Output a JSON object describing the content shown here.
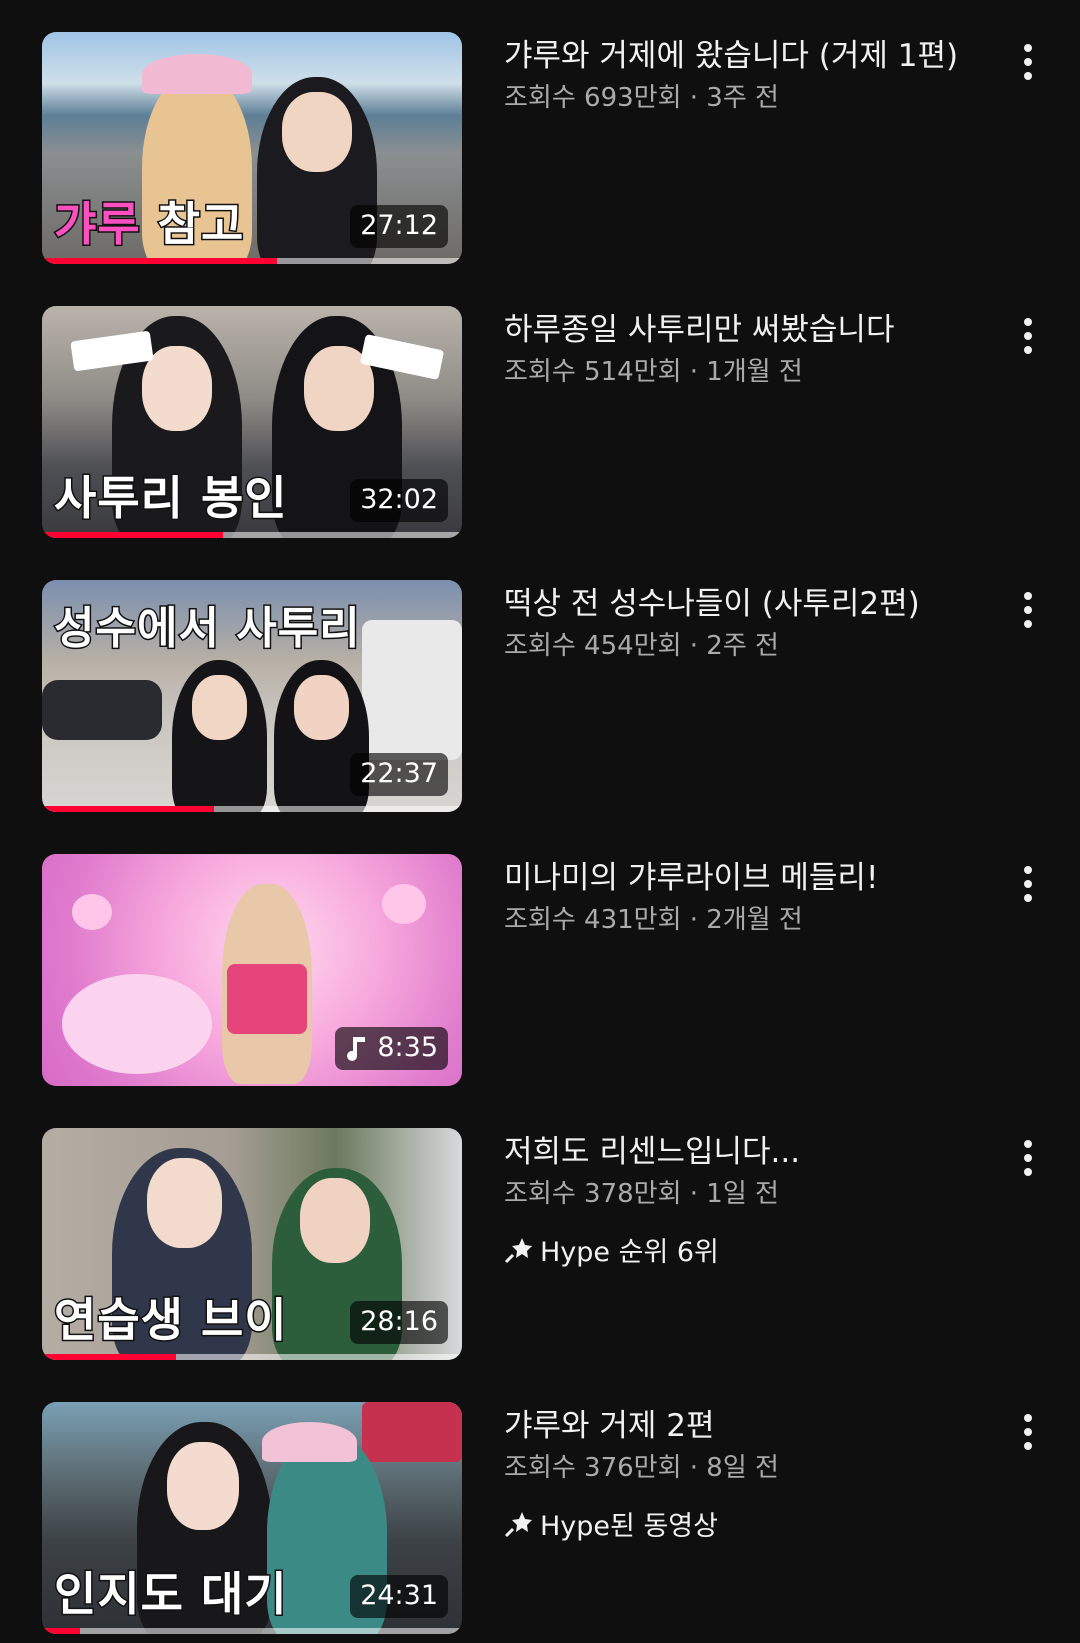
{
  "colors": {
    "background": "#0f0f0f",
    "progress": "#ff0033",
    "secondary_text": "#aaaaaa"
  },
  "videos": [
    {
      "title": "갸루와 거제에 왔습니다 (거제 1편)",
      "views": "조회수 693만회 · 3주 전",
      "duration": "27:12",
      "thumb_caption_pink": "갸루",
      "thumb_caption": " 참고",
      "watched": 0.56,
      "badge": ""
    },
    {
      "title": "하루종일 사투리만 써봤습니다",
      "views": "조회수 514만회 · 1개월 전",
      "duration": "32:02",
      "thumb_caption_pink": "",
      "thumb_caption": "사투리 봉인",
      "watched": 0.43,
      "badge": ""
    },
    {
      "title": "떡상 전 성수나들이 (사투리2편)",
      "views": "조회수 454만회 · 2주 전",
      "duration": "22:37",
      "thumb_caption_pink": "",
      "thumb_caption": "성수에서 사투리",
      "watched": 0.41,
      "badge": ""
    },
    {
      "title": "미나미의 갸루라이브 메들리!",
      "views": "조회수 431만회 · 2개월 전",
      "duration": "8:35",
      "duration_icon": "music-note-icon",
      "thumb_caption_pink": "",
      "thumb_caption": "",
      "watched": 0,
      "badge": ""
    },
    {
      "title": "저희도 리센느입니다...",
      "views": "조회수 378만회 · 1일 전",
      "duration": "28:16",
      "thumb_caption_pink": "",
      "thumb_caption": "연습생 브이",
      "watched": 0.32,
      "badge": "Hype 순위 6위",
      "badge_icon": "hype-sparkle-icon"
    },
    {
      "title": "갸루와 거제 2편",
      "views": "조회수 376만회 · 8일 전",
      "duration": "24:31",
      "thumb_caption_pink": "",
      "thumb_caption": "인지도 대기",
      "watched": 0.09,
      "badge": "Hype된 동영상",
      "badge_icon": "hype-sparkle-icon"
    }
  ]
}
